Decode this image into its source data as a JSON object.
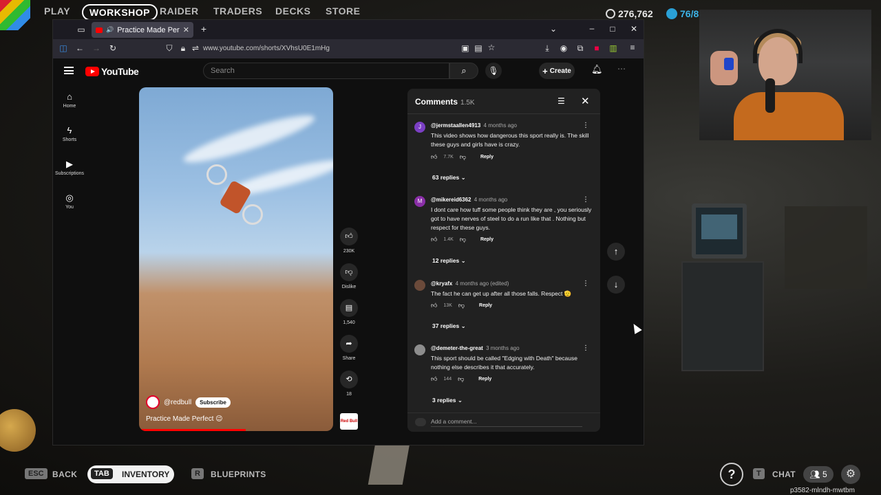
{
  "game": {
    "nav_tabs": [
      "PLAY",
      "WORKSHOP",
      "RAIDER",
      "TRADERS",
      "DECKS",
      "STORE"
    ],
    "active_tab": "WORKSHOP",
    "coins": "276,762",
    "credits": "76/8",
    "bottom": {
      "esc_key": "ESC",
      "back_label": "BACK",
      "tab_key": "TAB",
      "inventory_label": "INVENTORY",
      "r_key": "R",
      "blueprints_label": "BLUEPRINTS",
      "t_key": "T",
      "chat_label": "CHAT",
      "party_count": "5"
    },
    "session_code": "p3582-mlndh-mwtbm"
  },
  "browser": {
    "tab_title": "Practice Made Perfect 😉",
    "url": "www.youtube.com/shorts/XVhsU0E1mHg"
  },
  "youtube": {
    "logo_text": "YouTube",
    "search_placeholder": "Search",
    "create_label": "Create",
    "sidenav": [
      {
        "icon": "home-icon",
        "label": "Home"
      },
      {
        "icon": "shorts-icon",
        "label": "Shorts"
      },
      {
        "icon": "subscriptions-icon",
        "label": "Subscriptions"
      },
      {
        "icon": "you-icon",
        "label": "You"
      }
    ],
    "short": {
      "channel": "@redbull",
      "subscribe_label": "Subscribe",
      "title": "Practice Made Perfect 😉",
      "progress": 0.55
    },
    "actions": {
      "likes": "230K",
      "dislike_label": "Dislike",
      "comments": "1,540",
      "share_label": "Share",
      "remix": "18",
      "sound_thumb": "Red Bull"
    },
    "comments_panel": {
      "title": "Comments",
      "count": "1.5K",
      "add_placeholder": "Add a comment...",
      "items": [
        {
          "avatar": "J",
          "avatar_color": "#7b3fc4",
          "author": "@jermstaallen4913",
          "time": "4 months ago",
          "text": "This video shows how dangerous this sport really is. The skill these guys and girls have is crazy.",
          "likes": "7.7K",
          "reply_label": "Reply",
          "replies": "63 replies"
        },
        {
          "avatar": "M",
          "avatar_color": "#8a2fa8",
          "author": "@mikereid6362",
          "time": "4 months ago",
          "text": "I dont care how tuff some people think they are , you seriously got to have nerves of steel to do a run like that . Nothing but respect for these guys.",
          "likes": "1.4K",
          "reply_label": "Reply",
          "replies": "12 replies"
        },
        {
          "avatar": "",
          "avatar_color": "#6b4a3a",
          "author": "@kryafx",
          "time": "4 months ago (edited)",
          "text": "The fact he can get up after all those falls. Respect 🫡",
          "likes": "13K",
          "reply_label": "Reply",
          "replies": "37 replies"
        },
        {
          "avatar": "",
          "avatar_color": "#8d8d8d",
          "author": "@demeter-the-great",
          "time": "3 months ago",
          "text": "This sport should be called \"Edging with Death\" because nothing else describes it that accurately.",
          "likes": "144",
          "reply_label": "Reply",
          "replies": "3 replies"
        }
      ]
    }
  },
  "colors": {
    "youtube_red": "#ff0000",
    "panel_bg": "#212121",
    "page_bg": "#0f0f0f"
  }
}
